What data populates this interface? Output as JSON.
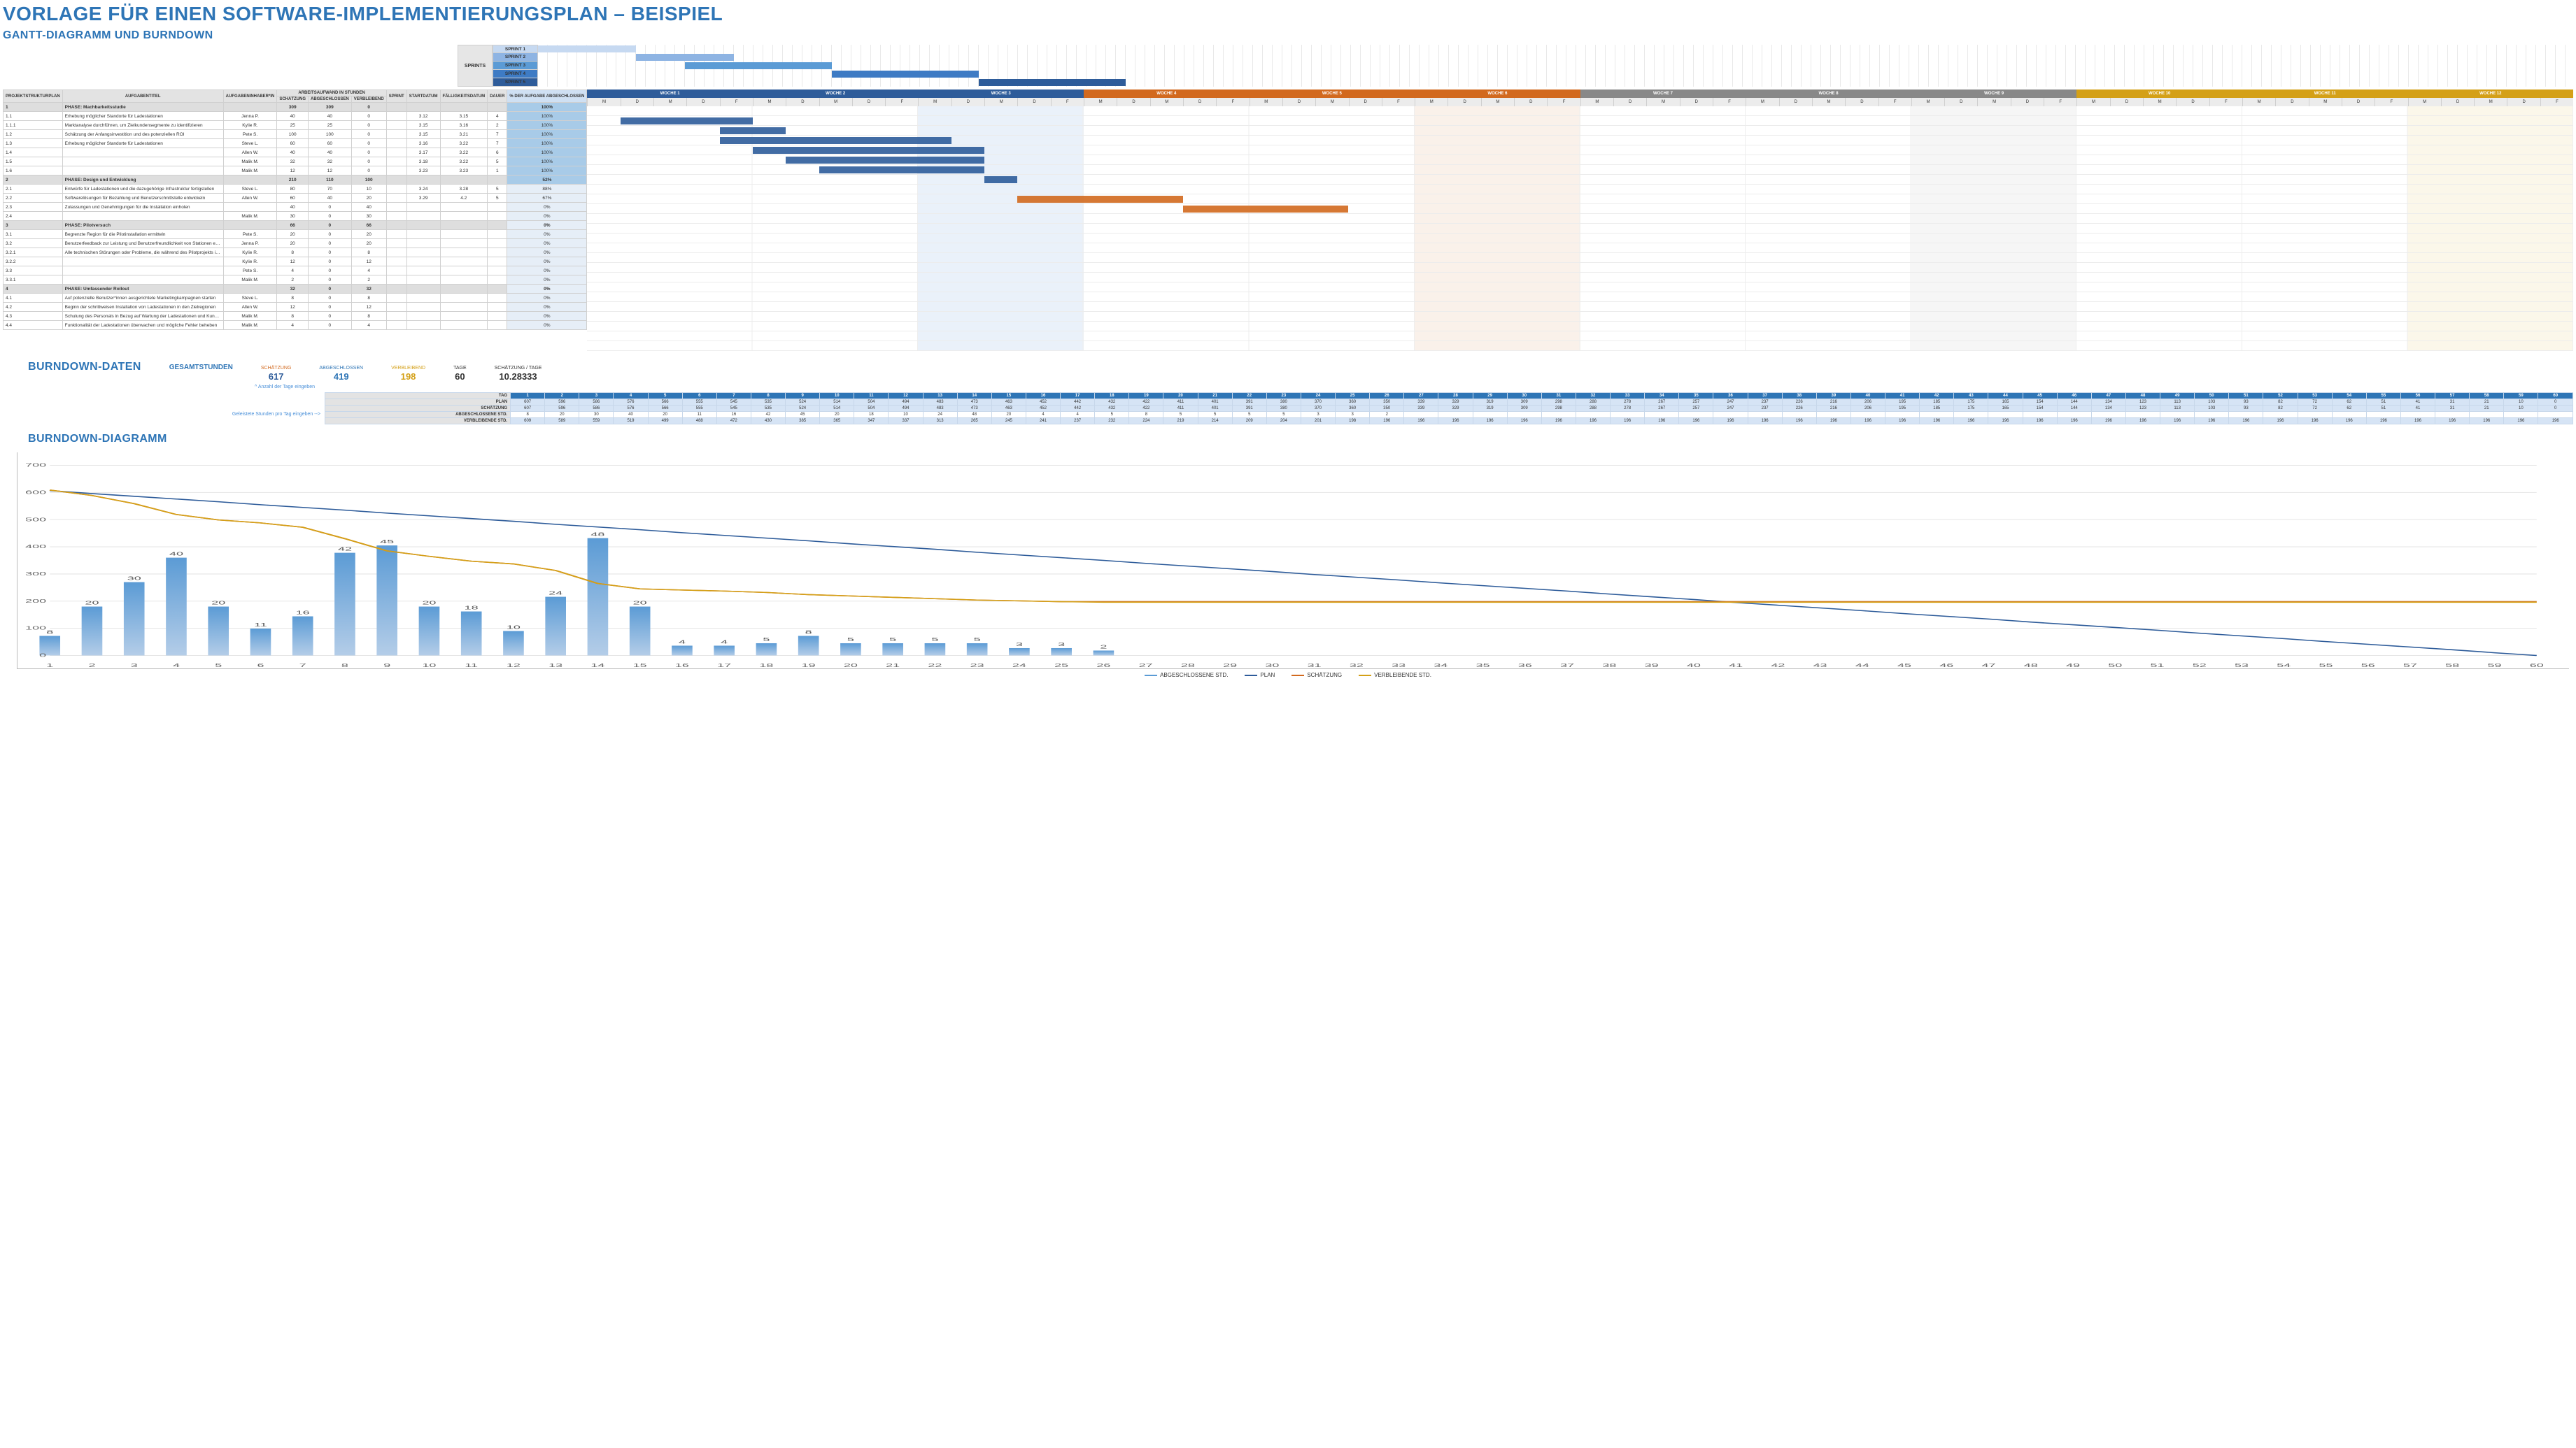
{
  "title": "VORLAGE FÜR EINEN SOFTWARE-IMPLEMENTIERUNGSPLAN – BEISPIEL",
  "section_gantt": "GANTT-DIAGRAMM UND BURNDOWN",
  "section_bd_data": "BURNDOWN-DATEN",
  "section_bd_chart": "BURNDOWN-DIAGRAMM",
  "sprints_label": "SPRINTS",
  "sprints": [
    {
      "name": "SPRINT 1",
      "start": 0,
      "len": 10,
      "color": "#c6d9f1"
    },
    {
      "name": "SPRINT 2",
      "start": 10,
      "len": 10,
      "color": "#8eb4e3"
    },
    {
      "name": "SPRINT 3",
      "start": 15,
      "len": 15,
      "color": "#5b9bd5"
    },
    {
      "name": "SPRINT 4",
      "start": 30,
      "len": 15,
      "color": "#3e7bc4"
    },
    {
      "name": "SPRINT 5",
      "start": 45,
      "len": 15,
      "color": "#2e5c9a"
    }
  ],
  "weeks": [
    {
      "label": "WOCHE 1",
      "color": "#2e5c9a"
    },
    {
      "label": "WOCHE 2",
      "color": "#2e5c9a"
    },
    {
      "label": "WOCHE 3",
      "color": "#2e5c9a"
    },
    {
      "label": "WOCHE 4",
      "color": "#d2691e"
    },
    {
      "label": "WOCHE 5",
      "color": "#d2691e"
    },
    {
      "label": "WOCHE 6",
      "color": "#d2691e"
    },
    {
      "label": "WOCHE 7",
      "color": "#888"
    },
    {
      "label": "WOCHE 8",
      "color": "#888"
    },
    {
      "label": "WOCHE 9",
      "color": "#888"
    },
    {
      "label": "WOCHE 10",
      "color": "#d4a017"
    },
    {
      "label": "WOCHE 11",
      "color": "#d4a017"
    },
    {
      "label": "WOCHE 12",
      "color": "#d4a017"
    }
  ],
  "days_of_week": [
    "M",
    "D",
    "M",
    "D",
    "F"
  ],
  "table_headers": {
    "wbs": "PROJEKTSTRUKTURPLAN",
    "title": "AUFGABENTITEL",
    "owner": "AUFGABENINHABER*IN",
    "effort_group": "ARBEITSAUFWAND IN STUNDEN",
    "est": "SCHÄTZUNG",
    "done": "ABGESCHLOSSEN",
    "rem": "VERBLEIBEND",
    "sprint": "SPRINT",
    "start": "STARTDATUM",
    "due": "FÄLLIGKEITSDATUM",
    "dur": "DAUER",
    "pct": "% DER AUFGABE ABGESCHLOSSEN"
  },
  "tasks": [
    {
      "wbs": "1",
      "phase": true,
      "title": "PHASE: Machbarkeitsstudie",
      "owner": "",
      "est": 309,
      "done": 309,
      "rem": 0,
      "sprint": "",
      "start": "",
      "due": "",
      "dur": "",
      "pct": "100%"
    },
    {
      "wbs": "1.1",
      "phase": false,
      "title": "Erhebung möglicher Standorte für Ladestationen",
      "owner": "Jenna P.",
      "est": 40,
      "done": 40,
      "rem": 0,
      "sprint": "",
      "start": "3.12",
      "due": "3.15",
      "dur": "4",
      "pct": "100%",
      "bar": {
        "d": 1,
        "l": 4,
        "c": "#2e5c9a"
      }
    },
    {
      "wbs": "1.1.1",
      "phase": false,
      "title": "Marktanalyse durchführen, um Zielkundensegmente zu identifizieren",
      "owner": "Kylie R.",
      "est": 25,
      "done": 25,
      "rem": 0,
      "sprint": "",
      "start": "3.15",
      "due": "3.16",
      "dur": "2",
      "pct": "100%",
      "bar": {
        "d": 4,
        "l": 2,
        "c": "#2e5c9a"
      }
    },
    {
      "wbs": "1.2",
      "phase": false,
      "title": "Schätzung der Anfangsinvestition und des potenziellen ROI",
      "owner": "Pete S.",
      "est": 100,
      "done": 100,
      "rem": 0,
      "sprint": "",
      "start": "3.15",
      "due": "3.21",
      "dur": "7",
      "pct": "100%",
      "bar": {
        "d": 4,
        "l": 7,
        "c": "#2e5c9a"
      }
    },
    {
      "wbs": "1.3",
      "phase": false,
      "title": "Erhebung möglicher Standorte für Ladestationen",
      "owner": "Steve L.",
      "est": 60,
      "done": 60,
      "rem": 0,
      "sprint": "",
      "start": "3.16",
      "due": "3.22",
      "dur": "7",
      "pct": "100%",
      "bar": {
        "d": 5,
        "l": 7,
        "c": "#2e5c9a"
      }
    },
    {
      "wbs": "1.4",
      "phase": false,
      "title": "",
      "owner": "Allen W.",
      "est": 40,
      "done": 40,
      "rem": 0,
      "sprint": "",
      "start": "3.17",
      "due": "3.22",
      "dur": "6",
      "pct": "100%",
      "bar": {
        "d": 6,
        "l": 6,
        "c": "#2e5c9a"
      }
    },
    {
      "wbs": "1.5",
      "phase": false,
      "title": "",
      "owner": "Malik M.",
      "est": 32,
      "done": 32,
      "rem": 0,
      "sprint": "",
      "start": "3.18",
      "due": "3.22",
      "dur": "5",
      "pct": "100%",
      "bar": {
        "d": 7,
        "l": 5,
        "c": "#2e5c9a"
      }
    },
    {
      "wbs": "1.6",
      "phase": false,
      "title": "",
      "owner": "Malik M.",
      "est": 12,
      "done": 12,
      "rem": 0,
      "sprint": "",
      "start": "3.23",
      "due": "3.23",
      "dur": "1",
      "pct": "100%",
      "bar": {
        "d": 12,
        "l": 1,
        "c": "#2e5c9a"
      }
    },
    {
      "wbs": "2",
      "phase": true,
      "title": "PHASE: Design und Entwicklung",
      "owner": "",
      "est": 210,
      "done": 110,
      "rem": 100,
      "sprint": "",
      "start": "",
      "due": "",
      "dur": "",
      "pct": "52%",
      "pct_bg": "#a8cbe8"
    },
    {
      "wbs": "2.1",
      "phase": false,
      "title": "Entwürfe für Ladestationen und die dazugehörige Infrastruktur fertigstellen",
      "owner": "Steve L.",
      "est": 80,
      "done": 70,
      "rem": 10,
      "sprint": "",
      "start": "3.24",
      "due": "3.28",
      "dur": "5",
      "pct": "88%",
      "bar": {
        "d": 13,
        "l": 5,
        "c": "#d2691e"
      }
    },
    {
      "wbs": "2.2",
      "phase": false,
      "title": "Softwarelösungen für Bezahlung und Benutzerschnittstelle entwickeln",
      "owner": "Allen W.",
      "est": 60,
      "done": 40,
      "rem": 20,
      "sprint": "",
      "start": "3.29",
      "due": "4.2",
      "dur": "5",
      "pct": "67%",
      "bar": {
        "d": 18,
        "l": 5,
        "c": "#d2691e"
      }
    },
    {
      "wbs": "2.3",
      "phase": false,
      "title": "Zulassungen und Genehmigungen für die Installation einholen",
      "owner": "",
      "est": 40,
      "done": 0,
      "rem": 40,
      "sprint": "",
      "start": "",
      "due": "",
      "dur": "",
      "pct": "0%"
    },
    {
      "wbs": "2.4",
      "phase": false,
      "title": "",
      "owner": "Malik M.",
      "est": 30,
      "done": 0,
      "rem": 30,
      "sprint": "",
      "start": "",
      "due": "",
      "dur": "",
      "pct": "0%"
    },
    {
      "wbs": "3",
      "phase": true,
      "title": "PHASE: Pilotversuch",
      "owner": "",
      "est": 66,
      "done": 0,
      "rem": 66,
      "sprint": "",
      "start": "",
      "due": "",
      "dur": "",
      "pct": "0%"
    },
    {
      "wbs": "3.1",
      "phase": false,
      "title": "Begrenzte Region für die Pilotinstallation ermitteln",
      "owner": "Pete S.",
      "est": 20,
      "done": 0,
      "rem": 20,
      "sprint": "",
      "start": "",
      "due": "",
      "dur": "",
      "pct": "0%"
    },
    {
      "wbs": "3.2",
      "phase": false,
      "title": "Benutzerfeedback zur Leistung und Benutzerfreundlichkeit von Stationen einholen",
      "owner": "Jenna P.",
      "est": 20,
      "done": 0,
      "rem": 20,
      "sprint": "",
      "start": "",
      "due": "",
      "dur": "",
      "pct": "0%"
    },
    {
      "wbs": "3.2.1",
      "phase": false,
      "title": "Alle technischen Störungen oder Probleme, die während des Pilotprojekts identifiziert wurden, beheben.",
      "owner": "Kylie R.",
      "est": 8,
      "done": 0,
      "rem": 8,
      "sprint": "",
      "start": "",
      "due": "",
      "dur": "",
      "pct": "0%"
    },
    {
      "wbs": "3.2.2",
      "phase": false,
      "title": "",
      "owner": "Kylie R.",
      "est": 12,
      "done": 0,
      "rem": 12,
      "sprint": "",
      "start": "",
      "due": "",
      "dur": "",
      "pct": "0%"
    },
    {
      "wbs": "3.3",
      "phase": false,
      "title": "",
      "owner": "Pete S.",
      "est": 4,
      "done": 0,
      "rem": 4,
      "sprint": "",
      "start": "",
      "due": "",
      "dur": "",
      "pct": "0%"
    },
    {
      "wbs": "3.3.1",
      "phase": false,
      "title": "",
      "owner": "Malik M.",
      "est": 2,
      "done": 0,
      "rem": 2,
      "sprint": "",
      "start": "",
      "due": "",
      "dur": "",
      "pct": "0%"
    },
    {
      "wbs": "4",
      "phase": true,
      "title": "PHASE: Umfassender Rollout",
      "owner": "",
      "est": 32,
      "done": 0,
      "rem": 32,
      "sprint": "",
      "start": "",
      "due": "",
      "dur": "",
      "pct": "0%"
    },
    {
      "wbs": "4.1",
      "phase": false,
      "title": "Auf potenzielle Benutzer*innen ausgerichtete Marketingkampagnen starten",
      "owner": "Steve L.",
      "est": 8,
      "done": 0,
      "rem": 8,
      "sprint": "",
      "start": "",
      "due": "",
      "dur": "",
      "pct": "0%"
    },
    {
      "wbs": "4.2",
      "phase": false,
      "title": "Beginn der schrittweisen Installation von Ladestationen in den Zielregionen",
      "owner": "Allen W.",
      "est": 12,
      "done": 0,
      "rem": 12,
      "sprint": "",
      "start": "",
      "due": "",
      "dur": "",
      "pct": "0%"
    },
    {
      "wbs": "4.3",
      "phase": false,
      "title": "Schulung des Personals in Bezug auf Wartung der Ladestationen und Kundenbetreuung.",
      "owner": "Malik M.",
      "est": 8,
      "done": 0,
      "rem": 8,
      "sprint": "",
      "start": "",
      "due": "",
      "dur": "",
      "pct": "0%"
    },
    {
      "wbs": "4.4",
      "phase": false,
      "title": "Funktionalität der Ladestationen überwachen und mögliche Fehler beheben",
      "owner": "Malik M.",
      "est": 4,
      "done": 0,
      "rem": 4,
      "sprint": "",
      "start": "",
      "due": "",
      "dur": "",
      "pct": "0%"
    }
  ],
  "summary": {
    "total_label": "GESAMTSTUNDEN",
    "total": 617,
    "est_cap": "SCHÄTZUNG",
    "done_cap": "ABGESCHLOSSEN",
    "rem_cap": "VERBLEIBEND",
    "days_cap": "TAGE",
    "per_day_cap": "SCHÄTZUNG / TAGE",
    "done": 419,
    "rem": 198,
    "days": 60,
    "per_day": "10.28333",
    "days_note": "^ Anzahl der Tage eingeben",
    "hours_note": "Geleistete Stunden pro Tag eingeben -->"
  },
  "bd_headers": {
    "day": "TAG",
    "plan": "PLAN",
    "est": "SCHÄTZUNG",
    "done": "ABGESCHLOSSENE STD.",
    "rem": "VERBLEIBENDE STD."
  },
  "bd": {
    "day": [
      1,
      2,
      3,
      4,
      5,
      6,
      7,
      8,
      9,
      10,
      11,
      12,
      13,
      14,
      15,
      16,
      17,
      18,
      19,
      20,
      21,
      22,
      23,
      24,
      25,
      26,
      27,
      28,
      29,
      30,
      31,
      32,
      33,
      34,
      35,
      36,
      37,
      38,
      39,
      40,
      41,
      42,
      43,
      44,
      45,
      46,
      47,
      48,
      49,
      50,
      51,
      52,
      53,
      54,
      55,
      56,
      57,
      58,
      59,
      60
    ],
    "plan": [
      607,
      596,
      586,
      576,
      566,
      555,
      545,
      535,
      524,
      514,
      504,
      494,
      483,
      473,
      463,
      452,
      442,
      432,
      422,
      411,
      401,
      391,
      380,
      370,
      360,
      350,
      339,
      329,
      319,
      309,
      298,
      288,
      278,
      267,
      257,
      247,
      237,
      226,
      216,
      206,
      195,
      185,
      175,
      165,
      154,
      144,
      134,
      123,
      113,
      103,
      93,
      82,
      72,
      62,
      51,
      41,
      31,
      21,
      10,
      0
    ],
    "est": [
      607,
      596,
      586,
      576,
      566,
      555,
      545,
      535,
      524,
      514,
      504,
      494,
      483,
      473,
      463,
      452,
      442,
      432,
      422,
      411,
      401,
      391,
      380,
      370,
      360,
      350,
      339,
      329,
      319,
      309,
      298,
      288,
      278,
      267,
      257,
      247,
      237,
      226,
      216,
      206,
      195,
      185,
      175,
      165,
      154,
      144,
      134,
      123,
      113,
      103,
      93,
      82,
      72,
      62,
      51,
      41,
      31,
      21,
      10,
      0
    ],
    "done": [
      8,
      20,
      30,
      40,
      20,
      11,
      16,
      42,
      45,
      20,
      18,
      10,
      24,
      48,
      20,
      4,
      4,
      5,
      8,
      5,
      5,
      5,
      5,
      3,
      3,
      2,
      "",
      "",
      "",
      "",
      "",
      "",
      "",
      "",
      "",
      "",
      "",
      "",
      "",
      "",
      "",
      "",
      "",
      "",
      "",
      "",
      "",
      "",
      "",
      "",
      "",
      "",
      "",
      "",
      "",
      "",
      "",
      "",
      "",
      ""
    ],
    "rem": [
      609,
      589,
      559,
      519,
      499,
      488,
      472,
      430,
      385,
      365,
      347,
      337,
      313,
      265,
      245,
      241,
      237,
      232,
      224,
      219,
      214,
      209,
      204,
      201,
      198,
      196,
      196,
      196,
      196,
      196,
      196,
      196,
      196,
      196,
      196,
      196,
      196,
      196,
      196,
      196,
      196,
      196,
      196,
      196,
      196,
      196,
      196,
      196,
      196,
      196,
      196,
      196,
      196,
      196,
      196,
      196,
      196,
      196,
      196,
      196
    ]
  },
  "chart_data": {
    "type": "bar+line",
    "x": [
      1,
      2,
      3,
      4,
      5,
      6,
      7,
      8,
      9,
      10,
      11,
      12,
      13,
      14,
      15,
      16,
      17,
      18,
      19,
      20,
      21,
      22,
      23,
      24,
      25,
      26,
      27,
      28,
      29,
      30,
      31,
      32,
      33,
      34,
      35,
      36,
      37,
      38,
      39,
      40,
      41,
      42,
      43,
      44,
      45,
      46,
      47,
      48,
      49,
      50,
      51,
      52,
      53,
      54,
      55,
      56,
      57,
      58,
      59,
      60
    ],
    "bars": {
      "name": "ABGESCHLOSSENE STD.",
      "color": "#5b9bd5",
      "values": [
        8,
        20,
        30,
        40,
        20,
        11,
        16,
        42,
        45,
        20,
        18,
        10,
        24,
        48,
        20,
        4,
        4,
        5,
        8,
        5,
        5,
        5,
        5,
        3,
        3,
        2,
        0,
        0,
        0,
        0,
        0,
        0,
        0,
        0,
        0,
        0,
        0,
        0,
        0,
        0,
        0,
        0,
        0,
        0,
        0,
        0,
        0,
        0,
        0,
        0,
        0,
        0,
        0,
        0,
        0,
        0,
        0,
        0,
        0,
        0
      ]
    },
    "lines": [
      {
        "name": "PLAN",
        "color": "#2e5c9a",
        "values": [
          607,
          596,
          586,
          576,
          566,
          555,
          545,
          535,
          524,
          514,
          504,
          494,
          483,
          473,
          463,
          452,
          442,
          432,
          422,
          411,
          401,
          391,
          380,
          370,
          360,
          350,
          339,
          329,
          319,
          309,
          298,
          288,
          278,
          267,
          257,
          247,
          237,
          226,
          216,
          206,
          195,
          185,
          175,
          165,
          154,
          144,
          134,
          123,
          113,
          103,
          93,
          82,
          72,
          62,
          51,
          41,
          31,
          21,
          10,
          0
        ]
      },
      {
        "name": "SCHÄTZUNG",
        "color": "#d2691e",
        "values": [
          609,
          589,
          559,
          519,
          499,
          488,
          472,
          430,
          385,
          365,
          347,
          337,
          313,
          265,
          245,
          241,
          237,
          232,
          224,
          219,
          214,
          209,
          204,
          201,
          198,
          198,
          198,
          198,
          198,
          198,
          198,
          198,
          198,
          198,
          198,
          198,
          198,
          198,
          198,
          198,
          198,
          198,
          198,
          198,
          198,
          198,
          198,
          198,
          198,
          198,
          198,
          198,
          198,
          198,
          198,
          198,
          198,
          198,
          198,
          198
        ]
      },
      {
        "name": "VERBLEIBENDE STD.",
        "color": "#d4a017",
        "values": [
          609,
          589,
          559,
          519,
          499,
          488,
          472,
          430,
          385,
          365,
          347,
          337,
          313,
          265,
          245,
          241,
          237,
          232,
          224,
          219,
          214,
          209,
          204,
          201,
          198,
          196,
          196,
          196,
          196,
          196,
          196,
          196,
          196,
          196,
          196,
          196,
          196,
          196,
          196,
          196,
          196,
          196,
          196,
          196,
          196,
          196,
          196,
          196,
          196,
          196,
          196,
          196,
          196,
          196,
          196,
          196,
          196,
          196,
          196,
          196
        ]
      }
    ],
    "ylim": [
      0,
      700
    ],
    "yticks": [
      0,
      100,
      200,
      300,
      400,
      500,
      600,
      700
    ],
    "legend": [
      "ABGESCHLOSSENE STD.",
      "PLAN",
      "SCHÄTZUNG",
      "VERBLEIBENDE STD."
    ]
  }
}
